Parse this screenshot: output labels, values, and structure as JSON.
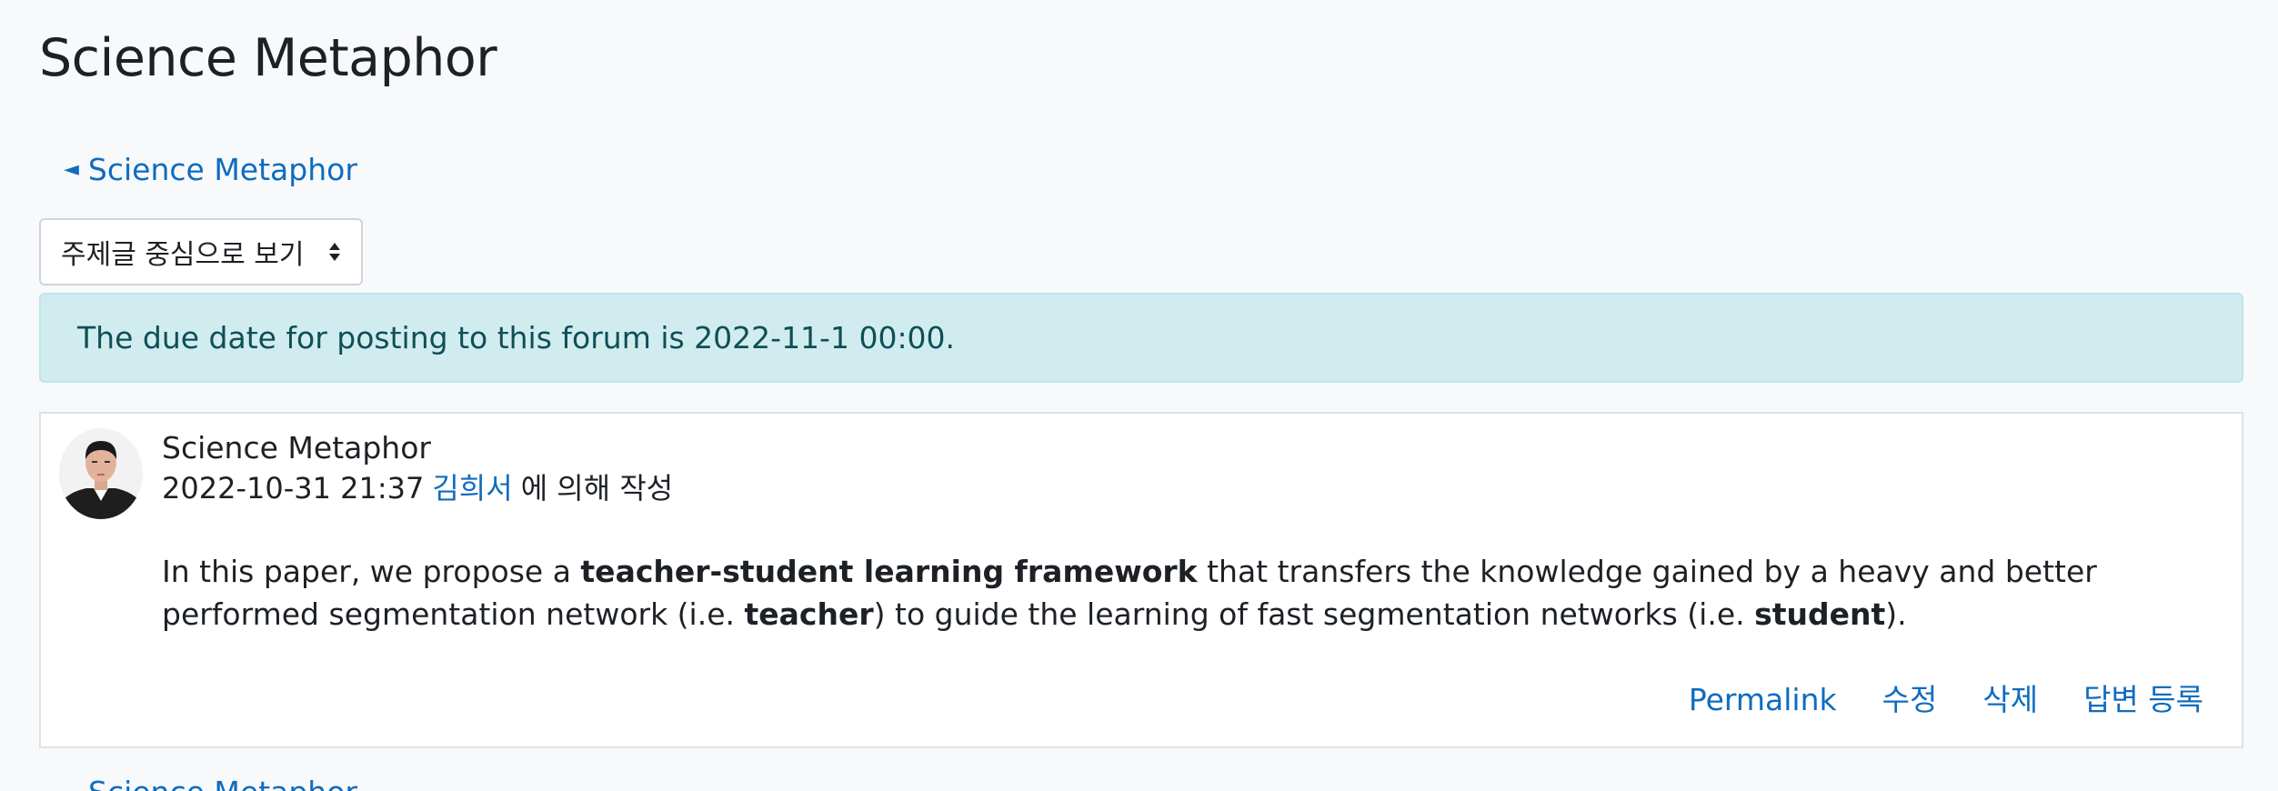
{
  "page": {
    "title": "Science Metaphor"
  },
  "back_link": {
    "arrow": "◄",
    "label": "Science Metaphor"
  },
  "view_select": {
    "selected": "주제글 중심으로 보기"
  },
  "alert": {
    "text": "The due date for posting to this forum is 2022-11-1 00:00."
  },
  "post": {
    "subject": "Science Metaphor",
    "date": "2022-10-31 21:37",
    "author": "김희서",
    "byline_suffix": "에 의해 작성",
    "body": {
      "part1": "In this paper, we propose a ",
      "bold1": "teacher-student learning framework",
      "part2": " that transfers the knowledge gained by a heavy and better performed segmentation network (i.e. ",
      "bold2": "teacher",
      "part3": ") to guide the learning of fast segmentation networks (i.e. ",
      "bold3": "student",
      "part4": ")."
    },
    "actions": {
      "permalink": "Permalink",
      "edit": "수정",
      "delete": "삭제",
      "reply": "답변 등록"
    }
  },
  "bottom_link": {
    "label": "Science Metaphor"
  },
  "colors": {
    "link": "#0f6cbf",
    "alert_bg": "#d1ecef",
    "alert_text": "#0f4f57",
    "page_bg": "#f8f9fa"
  },
  "icons": {
    "back": "back-arrow-icon",
    "select_caret": "sort-caret-icon",
    "avatar": "user-avatar"
  }
}
